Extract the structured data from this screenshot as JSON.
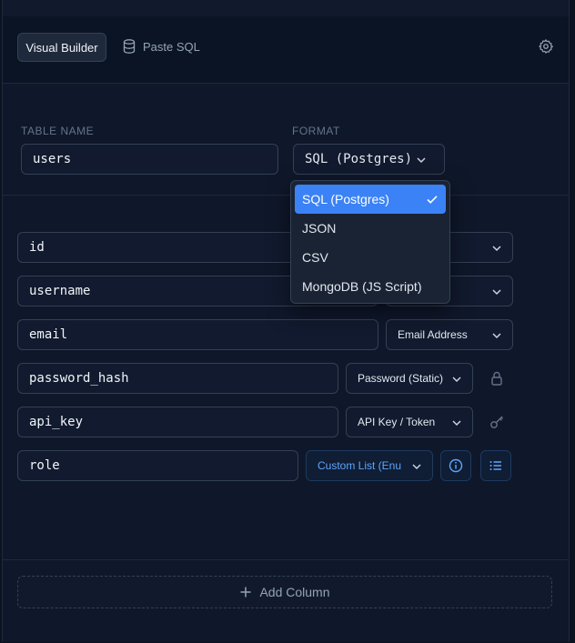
{
  "header": {
    "tabs": [
      {
        "label": "Visual Builder",
        "active": true
      },
      {
        "label": "Paste SQL",
        "icon": "database-icon",
        "active": false
      }
    ],
    "settings_icon": "gear-icon"
  },
  "settings": {
    "table_name_label": "TABLE NAME",
    "table_name_value": "users",
    "format_label": "FORMAT",
    "format_value": "SQL (Postgres)"
  },
  "format_dropdown": {
    "open": true,
    "options": [
      {
        "label": "SQL (Postgres)",
        "selected": true
      },
      {
        "label": "JSON",
        "selected": false
      },
      {
        "label": "CSV",
        "selected": false
      },
      {
        "label": "MongoDB (JS Script)",
        "selected": false
      }
    ]
  },
  "columns": [
    {
      "name": "id",
      "type": ""
    },
    {
      "name": "username",
      "type": ""
    },
    {
      "name": "email",
      "type": "Email Address"
    },
    {
      "name": "password_hash",
      "type": "Password (Static)",
      "icon": "lock-icon"
    },
    {
      "name": "api_key",
      "type": "API Key / Token",
      "icon": "key-icon"
    },
    {
      "name": "role",
      "type": "Custom List (Enum)",
      "icons": [
        "info-icon",
        "list-icon"
      ]
    }
  ],
  "footer": {
    "add_column_label": "Add Column",
    "add_icon": "plus-icon"
  },
  "colors": {
    "accent": "#3b82f6",
    "background": "#0f172a",
    "border": "#334155"
  }
}
